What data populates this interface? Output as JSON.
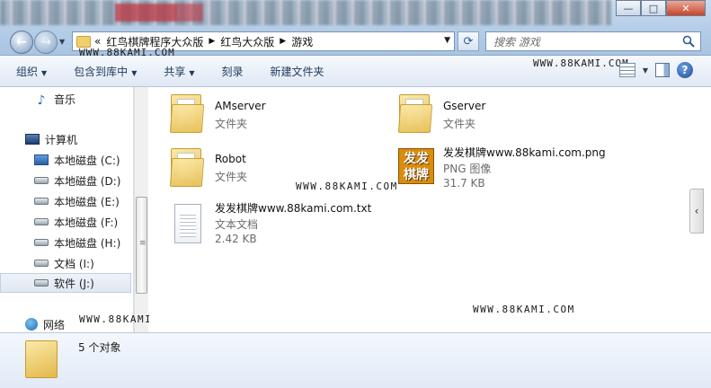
{
  "window": {
    "minimize": "—",
    "maximize": "□",
    "close": "✕"
  },
  "address": {
    "overflow": "«",
    "crumbs": [
      "红鸟棋牌程序大众版",
      "红鸟大众版",
      "游戏"
    ]
  },
  "search": {
    "placeholder": "搜索 游戏"
  },
  "toolbar": {
    "organize": "组织",
    "include": "包含到库中",
    "share": "共享",
    "burn": "刻录",
    "new_folder": "新建文件夹"
  },
  "nav": {
    "music": "音乐",
    "computer": "计算机",
    "drives": [
      "本地磁盘 (C:)",
      "本地磁盘 (D:)",
      "本地磁盘 (E:)",
      "本地磁盘 (F:)",
      "本地磁盘 (H:)",
      "文档 (I:)",
      "软件 (J:)"
    ],
    "network": "网络"
  },
  "files": [
    {
      "name": "AMserver",
      "type": "文件夹",
      "size": "",
      "icon": "folder-icon"
    },
    {
      "name": "Gserver",
      "type": "文件夹",
      "size": "",
      "icon": "folder-icon"
    },
    {
      "name": "Robot",
      "type": "文件夹",
      "size": "",
      "icon": "folder-icon"
    },
    {
      "name": "发发棋牌www.88kami.com.png",
      "type": "PNG 图像",
      "size": "31.7 KB",
      "icon": "png-image-icon"
    },
    {
      "name": "发发棋牌www.88kami.com.txt",
      "type": "文本文档",
      "size": "2.42 KB",
      "icon": "text-document-icon"
    }
  ],
  "png_thumb_text": [
    "发发",
    "棋牌"
  ],
  "watermark": "WWW.88KAMI.COM",
  "status": {
    "count": "5 个对象"
  }
}
